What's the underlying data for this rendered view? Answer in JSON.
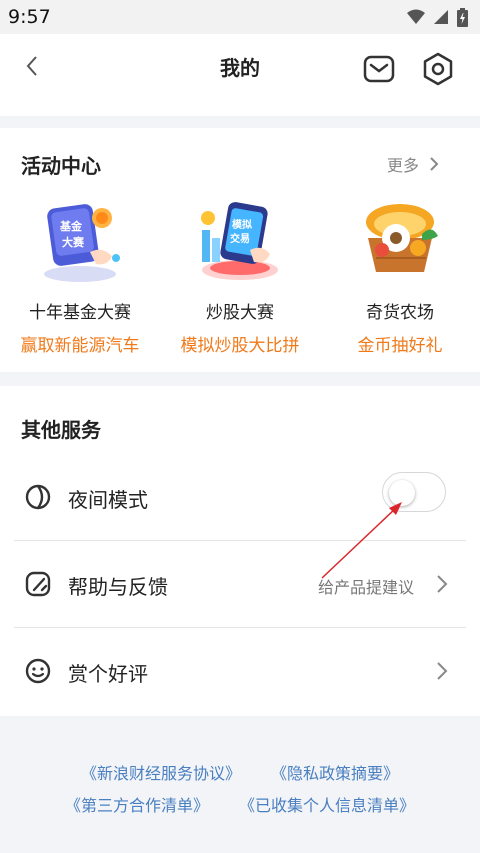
{
  "status": {
    "time": "9:57"
  },
  "header": {
    "title": "我的"
  },
  "activity": {
    "title": "活动中心",
    "more": "更多",
    "items": [
      {
        "name": "十年基金大赛",
        "sub": "赢取新能源汽车",
        "img_text": [
          "基金",
          "大赛"
        ]
      },
      {
        "name": "炒股大赛",
        "sub": "模拟炒股大比拼",
        "img_text": [
          "模拟",
          "交易"
        ]
      },
      {
        "name": "奇货农场",
        "sub": "金币抽好礼"
      }
    ]
  },
  "services": {
    "title": "其他服务",
    "night_mode": {
      "label": "夜间模式",
      "enabled": false
    },
    "help": {
      "label": "帮助与反馈",
      "hint": "给产品提建议"
    },
    "rate": {
      "label": "赏个好评"
    }
  },
  "footer": {
    "links": [
      "《新浪财经服务协议》",
      "《隐私政策摘要》",
      "《第三方合作清单》",
      "《已收集个人信息清单》"
    ]
  },
  "colors": {
    "accent_orange": "#f07a1a",
    "link_blue": "#4a7fc1",
    "annotation_red": "#d9262b"
  }
}
